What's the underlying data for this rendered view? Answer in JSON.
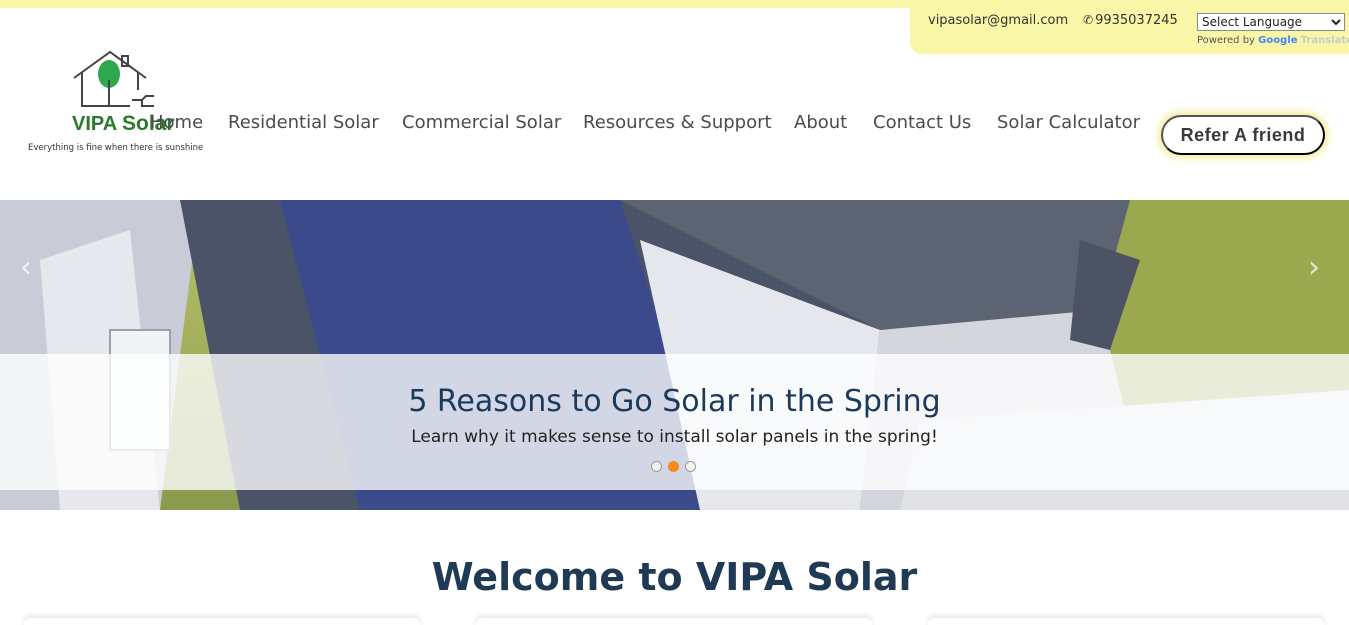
{
  "contact": {
    "email": "vipasolar@gmail.com",
    "phone": "9935037245",
    "phone_icon": "phone-icon",
    "language_select": "Select Language",
    "powered_by": "Powered by",
    "google": "Google",
    "translate": "Translate"
  },
  "logo": {
    "name_part1": "VIPA",
    "name_part2": "Solar",
    "tagline": "Everything is fine when there is sunshine"
  },
  "nav": {
    "items": [
      "Home",
      "Residential Solar",
      "Commercial Solar",
      "Resources & Support",
      "About",
      "Contact Us",
      "Solar Calculator"
    ]
  },
  "refer_button": "Refer A friend",
  "hero": {
    "prev_icon": "chevron-left-icon",
    "next_icon": "chevron-right-icon",
    "title": "5 Reasons to Go Solar in the Spring",
    "subtitle": "Learn why it makes sense to install solar panels in the spring!",
    "slide_count": 3,
    "active_slide": 2
  },
  "welcome": "Welcome to VIPA Solar",
  "colors": {
    "accent_yellow": "#faf6a8",
    "heading_navy": "#1e3a55",
    "logo_green": "#2a7a2e",
    "dot_active": "#f28a1e"
  }
}
